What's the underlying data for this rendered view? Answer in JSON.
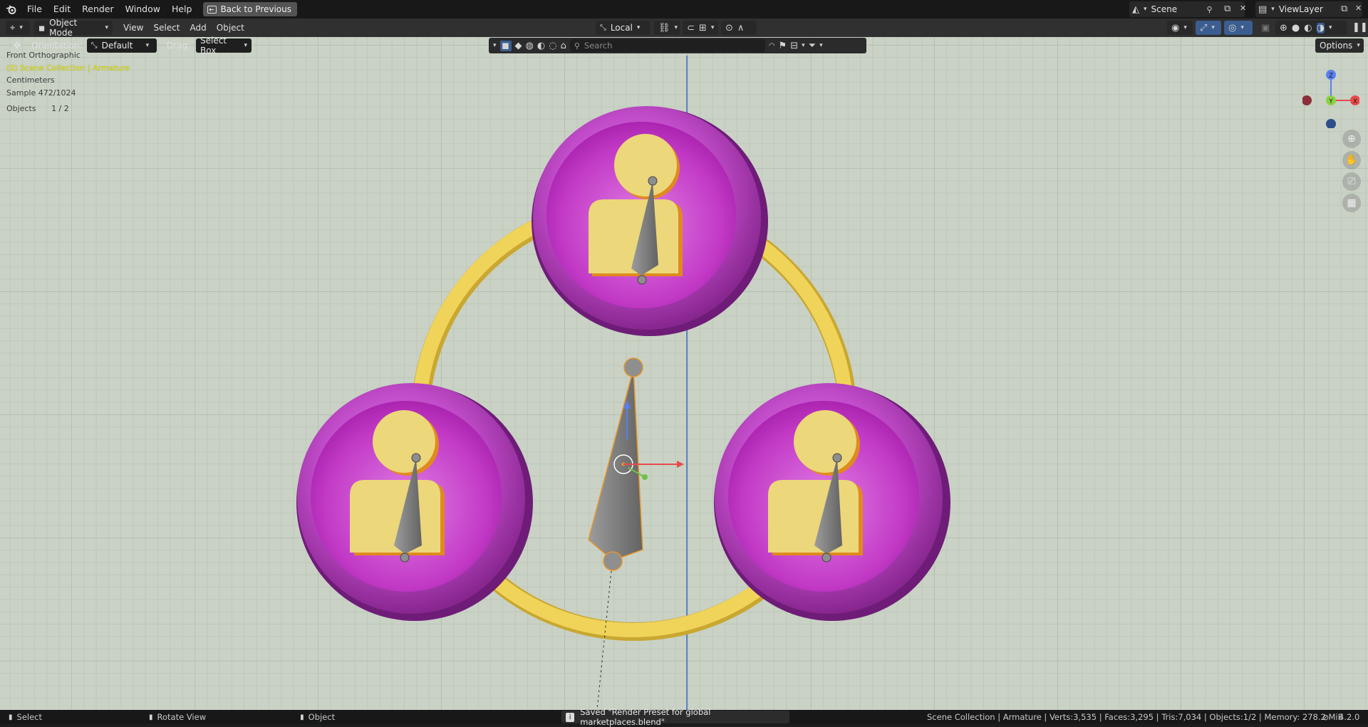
{
  "topbar": {
    "menus": [
      "File",
      "Edit",
      "Render",
      "Window",
      "Help"
    ],
    "back_button": "Back to Previous",
    "scene_name": "Scene",
    "view_layer": "ViewLayer"
  },
  "header": {
    "mode": "Object Mode",
    "menus": [
      "View",
      "Select",
      "Add",
      "Object"
    ],
    "pivot": "Local",
    "search_placeholder": "Search"
  },
  "tool_header": {
    "orientation_label": "Orientation:",
    "orientation_value": "Default",
    "drag_label": "Drag:",
    "drag_value": "Select Box",
    "options_label": "Options"
  },
  "viewport_info": {
    "view": "Front Orthographic",
    "collection": "(0) Scene Collection | Armature",
    "units": "Centimeters",
    "sample": "Sample 472/1024",
    "objects_label": "Objects",
    "objects_value": "1 / 2"
  },
  "gizmo": {
    "z": "Z",
    "y": "Y",
    "x": "X"
  },
  "statusbar": {
    "select": "Select",
    "rotate": "Rotate View",
    "object": "Object",
    "message": "Saved \"Render Preset for global marketplaces.blend\"",
    "stats": "Scene Collection | Armature | Verts:3,535 | Faces:3,295 | Tris:7,034 | Objects:1/2 | Memory: 278.2 MiB",
    "version": "4.2.0"
  },
  "colors": {
    "viewport_bg": "#c9d2c5",
    "ring_yellow": "#f0d45a",
    "disc_purple": "#b040c0",
    "person_yellow": "#ecd77a",
    "bone_grey": "#808080"
  }
}
